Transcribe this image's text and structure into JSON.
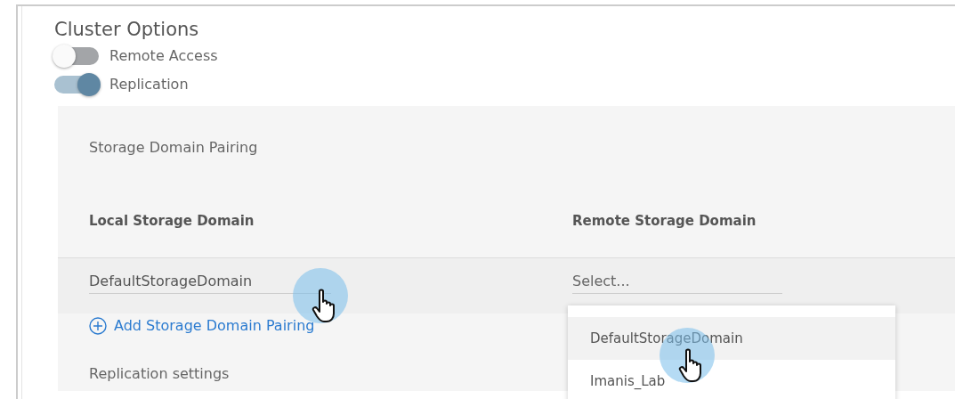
{
  "title": "Cluster Options",
  "toggles": [
    {
      "label": "Remote Access",
      "on": false
    },
    {
      "label": "Replication",
      "on": true
    }
  ],
  "pairing": {
    "title": "Storage Domain Pairing",
    "columns": [
      "Local Storage Domain",
      "Remote Storage Domain"
    ],
    "rows": [
      {
        "local": "DefaultStorageDomain",
        "remote": {
          "placeholder": "Select..."
        }
      }
    ],
    "add_link": "Add Storage Domain Pairing",
    "settings_title": "Replication settings"
  },
  "dropdown": {
    "options": [
      {
        "label": "DefaultStorageDomain",
        "hovered": true
      },
      {
        "label": "Imanis_Lab",
        "hovered": false
      }
    ]
  }
}
